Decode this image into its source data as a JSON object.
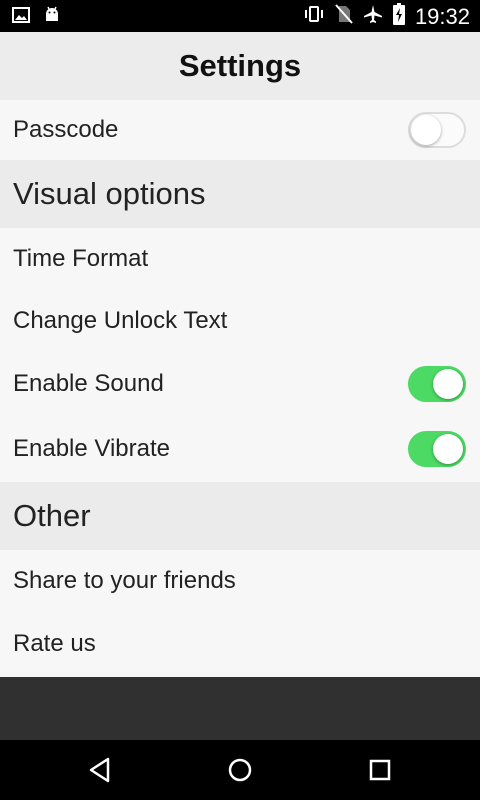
{
  "status_bar": {
    "time": "19:32",
    "left_icons": [
      "image-icon",
      "android-icon"
    ],
    "right_icons": [
      "vibrate-icon",
      "no-sim-icon",
      "airplane-icon",
      "battery-charging-icon"
    ]
  },
  "header": {
    "title": "Settings"
  },
  "rows": {
    "passcode": {
      "label": "Passcode",
      "toggle": false
    },
    "visual_options": {
      "label": "Visual options"
    },
    "time_format": {
      "label": "Time Format"
    },
    "change_unlock_text": {
      "label": "Change Unlock Text"
    },
    "enable_sound": {
      "label": "Enable Sound",
      "toggle": true
    },
    "enable_vibrate": {
      "label": "Enable Vibrate",
      "toggle": true
    },
    "other": {
      "label": "Other"
    },
    "share": {
      "label": "Share to your friends"
    },
    "rate": {
      "label": "Rate us"
    }
  },
  "nav": {
    "icons": [
      "back-icon",
      "home-icon",
      "recents-icon"
    ]
  },
  "colors": {
    "toggle_on": "#4cd964",
    "header_bg": "#ececec",
    "section_bg": "#ebebeb"
  }
}
